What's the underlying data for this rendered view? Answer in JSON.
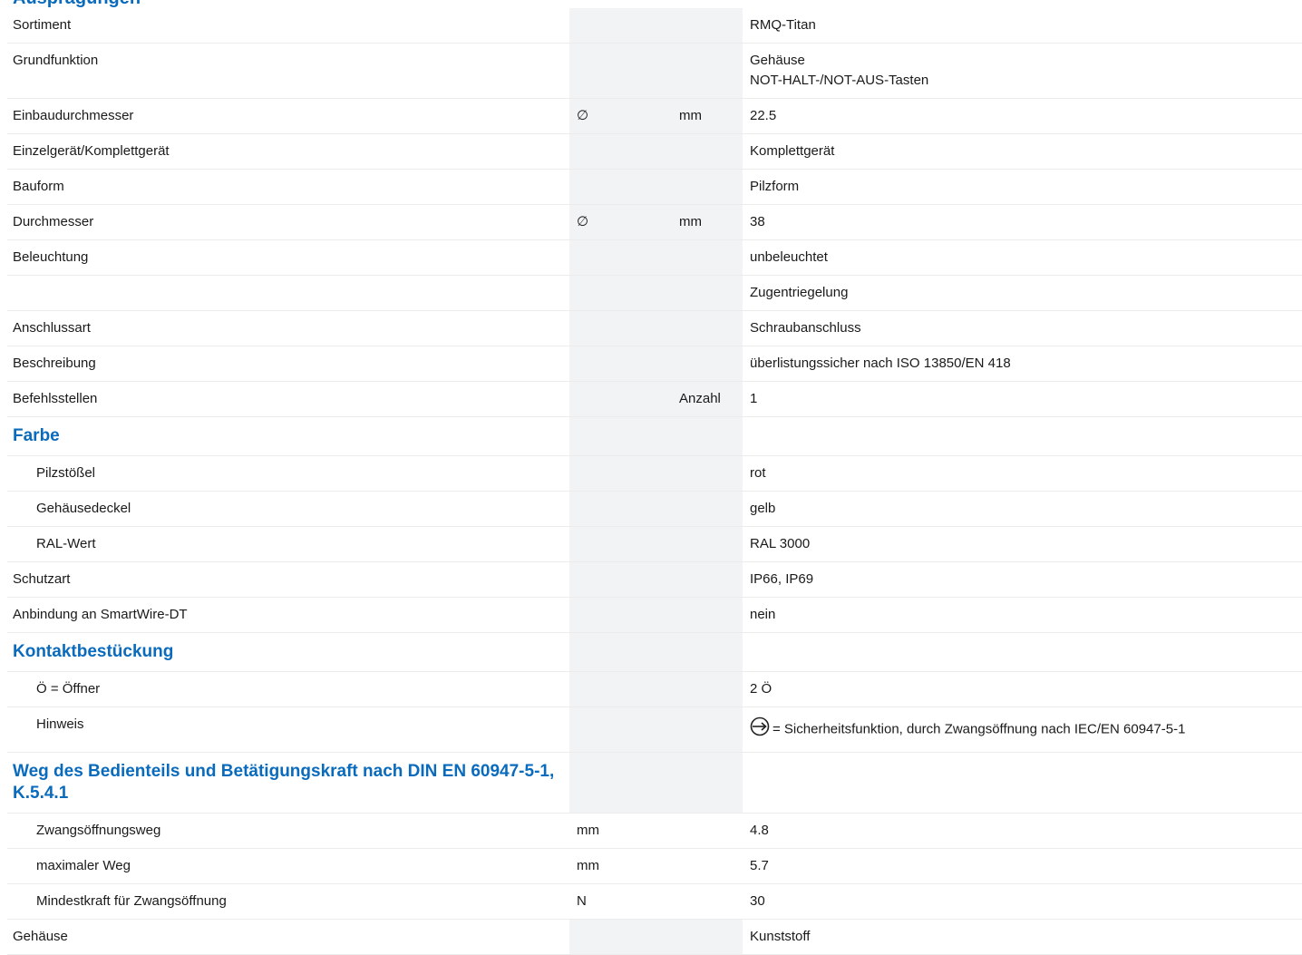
{
  "cut_heading": "Ausprägungen",
  "rows": [
    {
      "label": "Sortiment",
      "sym": "",
      "unit": "",
      "value": "RMQ-Titan"
    },
    {
      "label": "Grundfunktion",
      "sym": "",
      "unit": "",
      "value": "Gehäuse",
      "value2": "NOT-HALT-/NOT-AUS-Tasten"
    },
    {
      "label": "Einbaudurchmesser",
      "sym": "∅",
      "unit": "mm",
      "value": "22.5"
    },
    {
      "label": "Einzelgerät/Komplettgerät",
      "sym": "",
      "unit": "",
      "value": "Komplettgerät"
    },
    {
      "label": "Bauform",
      "sym": "",
      "unit": "",
      "value": "Pilzform"
    },
    {
      "label": "Durchmesser",
      "sym": "∅",
      "unit": "mm",
      "value": "38"
    },
    {
      "label": "Beleuchtung",
      "sym": "",
      "unit": "",
      "value": "unbeleuchtet"
    },
    {
      "label": "",
      "sym": "",
      "unit": "",
      "value": "Zugentriegelung"
    },
    {
      "label": "Anschlussart",
      "sym": "",
      "unit": "",
      "value": "Schraubanschluss"
    },
    {
      "label": "Beschreibung",
      "sym": "",
      "unit": "",
      "value": "überlistungssicher nach ISO 13850/EN 418"
    },
    {
      "label": "Befehlsstellen",
      "sym": "",
      "unit": "Anzahl",
      "value": "1"
    }
  ],
  "farbe": {
    "heading": "Farbe",
    "rows": [
      {
        "label": "Pilzstößel",
        "value": "rot"
      },
      {
        "label": "Gehäusedeckel",
        "value": "gelb"
      },
      {
        "label": "RAL-Wert",
        "value": "RAL 3000"
      }
    ]
  },
  "rows2": [
    {
      "label": "Schutzart",
      "value": "IP66, IP69"
    },
    {
      "label": "Anbindung an SmartWire-DT",
      "value": "nein"
    }
  ],
  "kontakt": {
    "heading": "Kontaktbestückung",
    "rows": [
      {
        "label": "Ö = Öffner",
        "value": "2 Ö"
      }
    ],
    "hinweis_label": "Hinweis",
    "hinweis_text": "= Sicherheitsfunktion, durch Zwangsöffnung nach IEC/EN 60947-5-1",
    "hinweis_icon": "forced-opening-symbol-icon"
  },
  "weg": {
    "heading": "Weg des Bedienteils und Betätigungskraft nach DIN EN 60947-5-1, K.5.4.1",
    "rows": [
      {
        "label": "Zwangsöffnungsweg",
        "unit": "mm",
        "value": "4.8"
      },
      {
        "label": "maximaler Weg",
        "unit": "mm",
        "value": "5.7"
      },
      {
        "label": "Mindestkraft für Zwangsöffnung",
        "unit": "N",
        "value": "30"
      }
    ]
  },
  "last": {
    "label": "Gehäuse",
    "value": "Kunststoff"
  }
}
